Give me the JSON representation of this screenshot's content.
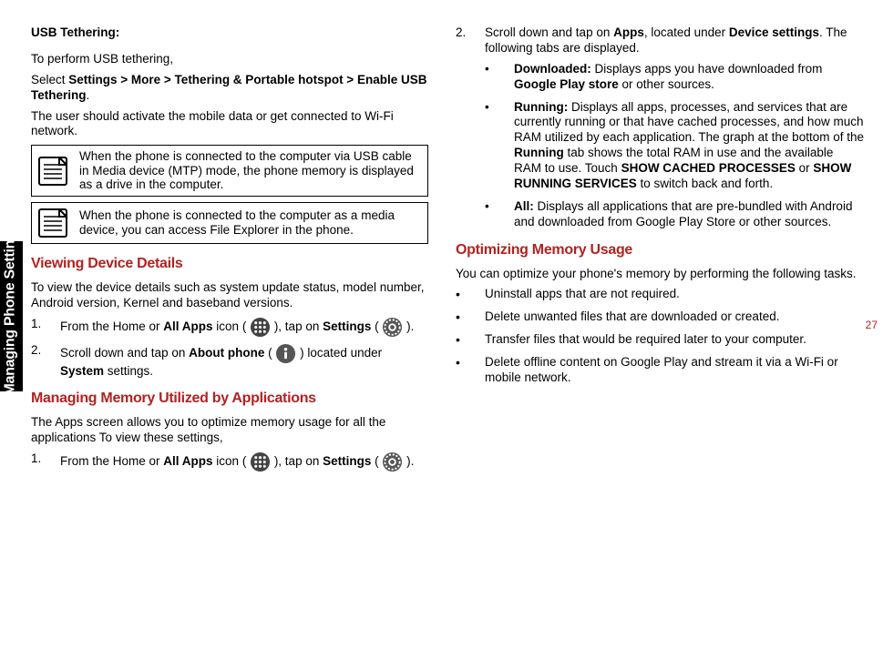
{
  "sidebar": {
    "label": "Managing Phone Settings"
  },
  "page_number": "27",
  "left": {
    "usb_title": "USB Tethering:",
    "usb_intro": "To perform USB tethering,",
    "select_prefix": "Select ",
    "select_bold": "Settings > More > Tethering & Portable hotspot > Enable USB Tethering",
    "select_suffix": ".",
    "usb_activate": "The user should activate the mobile data or get connected to Wi-Fi network.",
    "note1": "When the phone is connected to the computer via USB cable in Media device (MTP) mode, the phone memory is displayed as a drive in the computer.",
    "note2": "When the phone is connected to the computer as a media device, you can access File Explorer in the phone.",
    "viewing_head": "Viewing Device Details",
    "viewing_body": "To view the device details such as system update status, model number, Android version, Kernel and baseband versions.",
    "step1_a": "From the Home or ",
    "step1_b_bold": "All Apps",
    "step1_c": " icon ( ",
    "step1_d": " ), tap on ",
    "step1_e_bold": "Settings",
    "step1_f": " ( ",
    "step1_g": " ).",
    "step2_a": "Scroll down and tap on ",
    "step2_b_bold": "About phone",
    "step2_c": " ( ",
    "step2_d": " ) located under ",
    "step2_e_bold": "System",
    "step2_f": " settings.",
    "mem_head": "Managing Memory Utilized by Applications",
    "mem_body": "The Apps screen allows you to optimize memory usage for all the applications To view these settings,",
    "mem_step1_a": "From the Home or ",
    "mem_step1_b_bold": "All Apps",
    "mem_step1_c": " icon ( ",
    "mem_step1_d": " ), tap on ",
    "mem_step1_e_bold": "Settings",
    "mem_step1_f": " ( ",
    "mem_step1_g": " )."
  },
  "right": {
    "step2_a": "Scroll down and tap on ",
    "step2_b_bold": "Apps",
    "step2_c": ", located under ",
    "step2_d_bold": "Device settings",
    "step2_e": ". The following tabs are displayed.",
    "downloaded_label": "Downloaded: ",
    "downloaded_t1": "Displays apps you have downloaded from ",
    "downloaded_bold2": "Google Play store",
    "downloaded_t2": " or other sources.",
    "running_label": "Running: ",
    "running_t1": "Displays all apps, processes, and services that are currently running or that have cached processes, and how much RAM utilized by each application. The graph at the bottom of the ",
    "running_bold2": "Running",
    "running_t2": " tab shows the total RAM in use and the available RAM to use. Touch ",
    "running_bold3": "SHOW CACHED PROCESSES",
    "running_t3": " or ",
    "running_bold4": "SHOW RUNNING SERVICES",
    "running_t4": " to switch back and forth.",
    "all_label": "All: ",
    "all_t1": "Displays all applications that are pre-bundled with Android and downloaded from Google Play Store or other sources.",
    "optimize_head": "Optimizing Memory Usage",
    "optimize_body": "You can optimize your phone's memory by performing the following tasks.",
    "opt_b1": "Uninstall apps that are not required.",
    "opt_b2": "Delete unwanted files that are downloaded or created.",
    "opt_b3": "Transfer files that would be required later to your computer.",
    "opt_b4": "Delete offline content on Google Play and stream it via a Wi-Fi or mobile network."
  }
}
